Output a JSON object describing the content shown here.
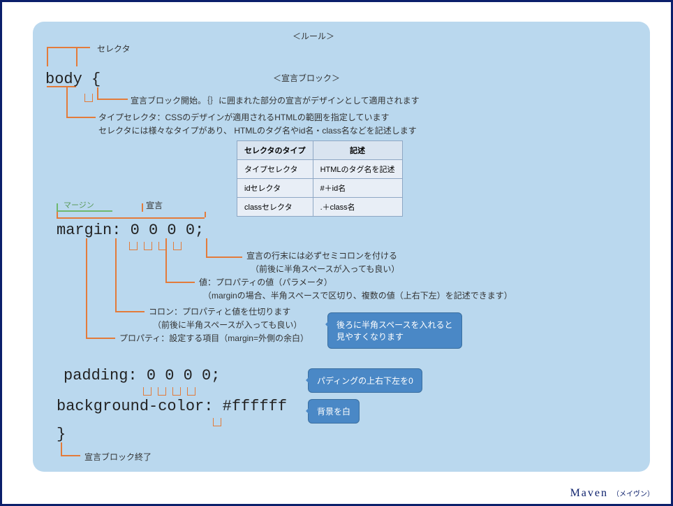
{
  "title_rule": "＜ルール＞",
  "title_decl": "＜宣言ブロック＞",
  "labels": {
    "selector": "セレクタ",
    "declaration": "宣言",
    "margin": "マージン",
    "block_end": "宣言ブロック終了"
  },
  "code": {
    "body_open": "body {",
    "margin_line": "margin: 0 0 0 0;",
    "padding_line": "padding: 0 0 0 0;",
    "bg_line": "background-color: #ffffff",
    "close": "}"
  },
  "notes": {
    "block_start": "宣言ブロック開始。｛｝に囲まれた部分の宣言がデザインとして適用されます",
    "type_selector": "タイプセレクタ：CSSのデザインが適用されるHTMLの範囲を指定しています\nセレクタには様々なタイプがあり、 HTMLのタグ名やid名・class名などを記述します",
    "semicolon": "宣言の行末には必ずセミコロンを付ける\n　（前後に半角スペースが入っても良い）",
    "value": "値：プロパティの値（パラメータ）\n　（marginの場合、半角スペースで区切り、複数の値（上右下左）を記述できます）",
    "colon": "コロン：プロパティと値を仕切ります\n　（前後に半角スペースが入っても良い）",
    "property": "プロパティ：設定する項目（margin=外側の余白）"
  },
  "callouts": {
    "space_tip": "後ろに半角スペースを入れると\n見やすくなります",
    "padding_tip": "パディングの上右下左を0",
    "bg_tip": "背景を白"
  },
  "table": {
    "h1": "セレクタのタイプ",
    "h2": "記述",
    "r1c1": "タイプセレクタ",
    "r1c2": "HTMLのタグ名を記述",
    "r2c1": "idセレクタ",
    "r2c2": "#＋id名",
    "r3c1": "classセレクタ",
    "r3c2": ".＋class名"
  },
  "footer": "Maven",
  "footer_sub": "（メイヴン）"
}
